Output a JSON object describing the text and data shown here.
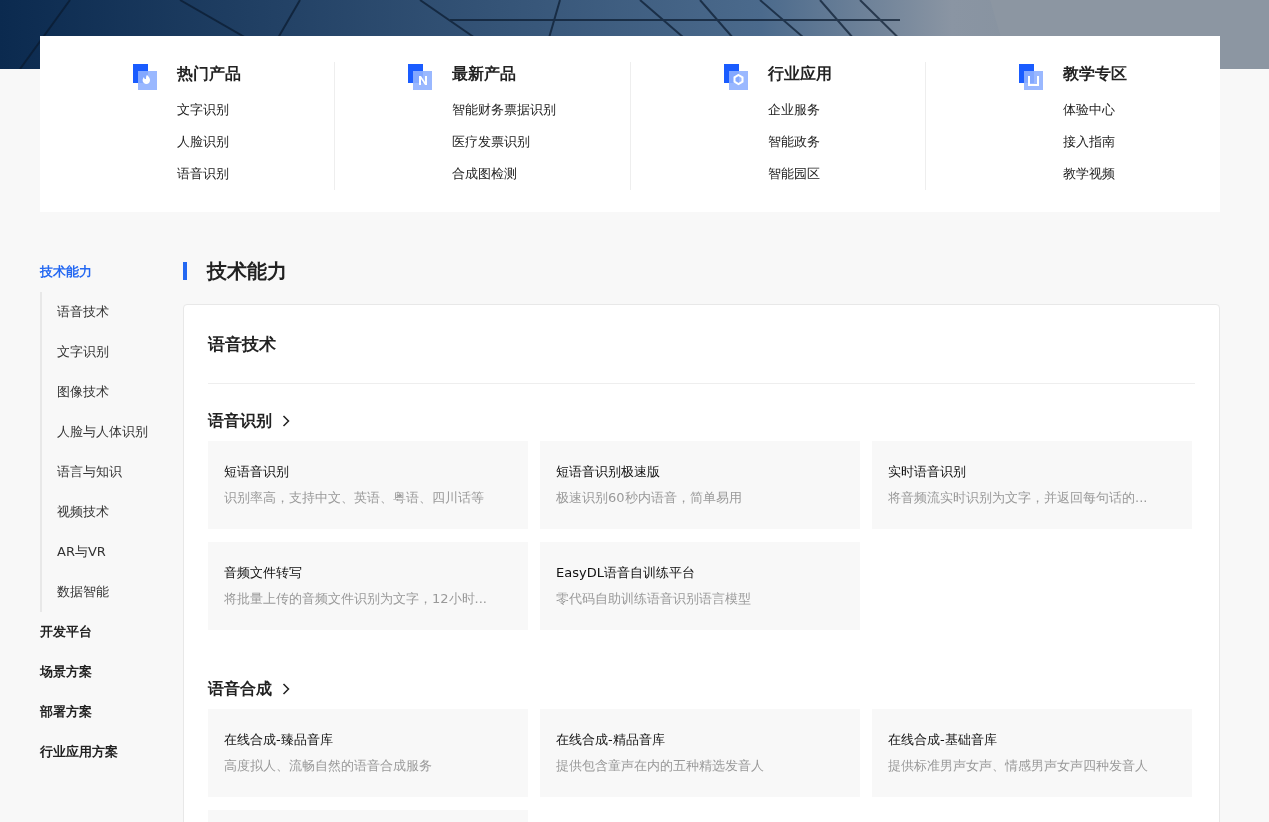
{
  "nav_columns": [
    {
      "title": "热门产品",
      "links": [
        "文字识别",
        "人脸识别",
        "语音识别"
      ]
    },
    {
      "title": "最新产品",
      "links": [
        "智能财务票据识别",
        "医疗发票识别",
        "合成图检测"
      ]
    },
    {
      "title": "行业应用",
      "links": [
        "企业服务",
        "智能政务",
        "智能园区"
      ]
    },
    {
      "title": "教学专区",
      "links": [
        "体验中心",
        "接入指南",
        "教学视频"
      ]
    }
  ],
  "sidebar": {
    "items": [
      {
        "label": "技术能力",
        "selected": true,
        "children": [
          {
            "label": "语音技术",
            "selected": false
          },
          {
            "label": "文字识别",
            "selected": false
          },
          {
            "label": "图像技术",
            "selected": false
          },
          {
            "label": "人脸与人体识别",
            "selected": false
          },
          {
            "label": "语言与知识",
            "selected": false
          },
          {
            "label": "视频技术",
            "selected": false
          },
          {
            "label": "AR与VR",
            "selected": false
          },
          {
            "label": "数据智能",
            "selected": false
          }
        ]
      },
      {
        "label": "开发平台",
        "selected": false
      },
      {
        "label": "场景方案",
        "selected": false
      },
      {
        "label": "部署方案",
        "selected": false
      },
      {
        "label": "行业应用方案",
        "selected": false
      }
    ]
  },
  "section_title": "技术能力",
  "panel": {
    "title": "语音技术",
    "groups": [
      {
        "title": "语音识别",
        "cards": [
          {
            "kind": "product",
            "name": "短语音识别",
            "desc": "识别率高，支持中文、英语、粤语、四川话等"
          },
          {
            "kind": "product",
            "name": "短语音识别极速版",
            "desc": "极速识别60秒内语音，简单易用"
          },
          {
            "kind": "product",
            "name": "实时语音识别",
            "desc": "将音频流实时识别为文字，并返回每句话的..."
          },
          {
            "kind": "product",
            "name": "音频文件转写",
            "desc": "将批量上传的音频文件识别为文字，12小时..."
          },
          {
            "kind": "product",
            "name": "EasyDL语音自训练平台",
            "desc": "零代码自助训练语音识别语言模型"
          }
        ]
      },
      {
        "title": "语音合成",
        "cards": [
          {
            "kind": "product",
            "name": "在线合成-臻品音库",
            "desc": "高度拟人、流畅自然的语音合成服务"
          },
          {
            "kind": "product",
            "name": "在线合成-精品音库",
            "desc": "提供包含童声在内的五种精选发音人"
          },
          {
            "kind": "product",
            "name": "在线合成-基础音库",
            "desc": "提供标准男声女声、情感男声女声四种发音人"
          },
          {
            "kind": "cut"
          }
        ]
      }
    ]
  }
}
